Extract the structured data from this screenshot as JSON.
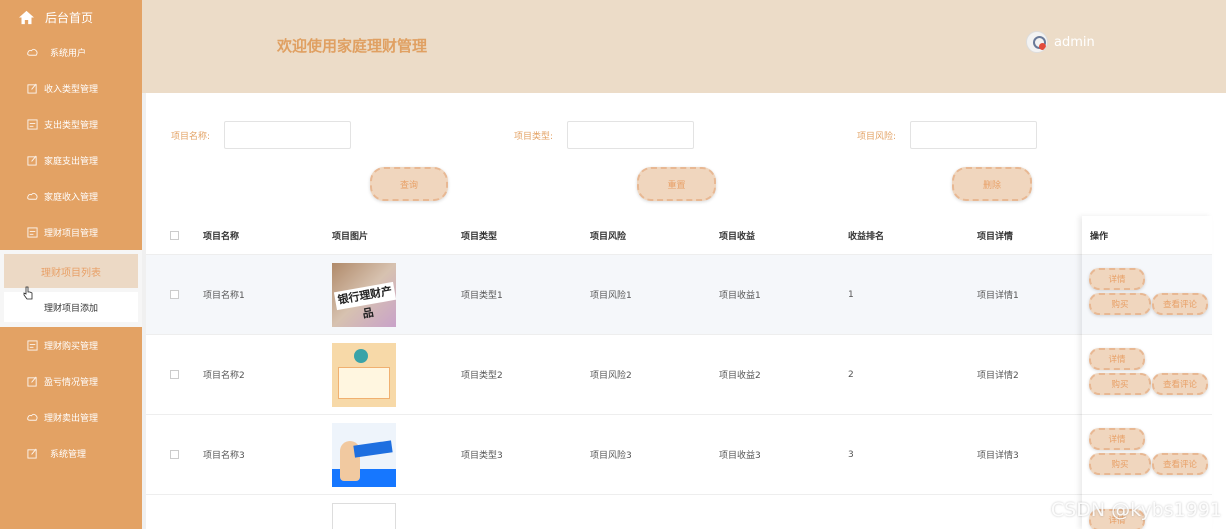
{
  "sidebar": {
    "brand": "后台首页",
    "items_top": [
      {
        "label": "系统用户",
        "icon": "cloud-icon"
      },
      {
        "label": "收入类型管理",
        "icon": "edit-icon"
      },
      {
        "label": "支出类型管理",
        "icon": "list-icon"
      },
      {
        "label": "家庭支出管理",
        "icon": "edit-icon"
      },
      {
        "label": "家庭收入管理",
        "icon": "cloud-icon"
      },
      {
        "label": "理财项目管理",
        "icon": "list-icon"
      }
    ],
    "submenu": [
      {
        "label": "理财项目列表"
      },
      {
        "label": "理财项目添加"
      }
    ],
    "items_bottom": [
      {
        "label": "理财购买管理",
        "icon": "list-icon"
      },
      {
        "label": "盈亏情况管理",
        "icon": "edit-icon"
      },
      {
        "label": "理财卖出管理",
        "icon": "cloud-icon"
      },
      {
        "label": "系统管理",
        "icon": "edit-icon"
      }
    ]
  },
  "header": {
    "welcome": "欢迎使用家庭理财管理",
    "username": "admin"
  },
  "search": {
    "name_label": "项目名称:",
    "type_label": "项目类型:",
    "risk_label": "项目风险:",
    "query_button": "查询",
    "reset_button": "重置",
    "delete_button": "删除"
  },
  "table": {
    "columns": [
      "项目名称",
      "项目图片",
      "项目类型",
      "项目风险",
      "项目收益",
      "收益排名",
      "项目详情",
      "操作"
    ],
    "rows": [
      {
        "name": "项目名称1",
        "image_text": "银行理财产品",
        "type": "项目类型1",
        "risk": "项目风险1",
        "earn": "项目收益1",
        "rank": "1",
        "detail": "项目详情1"
      },
      {
        "name": "项目名称2",
        "image_text": "",
        "type": "项目类型2",
        "risk": "项目风险2",
        "earn": "项目收益2",
        "rank": "2",
        "detail": "项目详情2"
      },
      {
        "name": "项目名称3",
        "image_text": "",
        "type": "项目类型3",
        "risk": "项目风险3",
        "earn": "项目收益3",
        "rank": "3",
        "detail": "项目详情3"
      }
    ],
    "actions": {
      "detail": "详情",
      "buy": "购买",
      "review": "查看评论"
    }
  },
  "watermark": "CSDN @kybs1991",
  "colors": {
    "sidebar": "#e3a264",
    "header": "#ecdcc8",
    "accent": "#e8a067"
  }
}
